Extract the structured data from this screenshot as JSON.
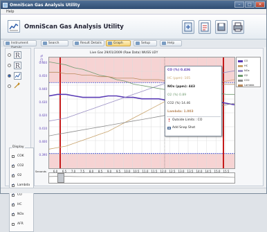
{
  "window": {
    "title": "OmniScan Gas Analysis Utility"
  },
  "menu": {
    "help": "Help"
  },
  "app": {
    "title": "OmniScan Gas Analysis Utility"
  },
  "toolbar": [
    {
      "icon": "export-icon"
    },
    {
      "icon": "settings-icon"
    },
    {
      "icon": "save-icon"
    },
    {
      "icon": "print-icon"
    }
  ],
  "tabs": [
    {
      "label": "Instrument Details",
      "active": false
    },
    {
      "label": "Search",
      "active": false
    },
    {
      "label": "Result Details",
      "active": false
    },
    {
      "label": "Graph",
      "active": true
    },
    {
      "label": "Setup",
      "active": false
    },
    {
      "label": "Help",
      "active": false
    }
  ],
  "sidebar": {
    "views": [
      {
        "icon": "data-view-icon",
        "selected": false
      },
      {
        "icon": "report-view-icon",
        "selected": false
      },
      {
        "icon": "graph-view-icon",
        "selected": true
      },
      {
        "icon": "tools-icon",
        "selected": false
      }
    ],
    "display_title": "Display",
    "gases": [
      {
        "label": "COK",
        "checked": false
      },
      {
        "label": "CO2",
        "checked": true
      },
      {
        "label": "O2",
        "checked": true
      },
      {
        "label": "Lambda",
        "checked": true
      },
      {
        "label": "CO",
        "checked": true
      },
      {
        "label": "HC",
        "checked": true
      },
      {
        "label": "NOx",
        "checked": true
      },
      {
        "label": "AFR",
        "checked": false
      }
    ]
  },
  "chart": {
    "title": "Live Gas 29/01/2009 (Raw Data) WUSS U2Y",
    "ylabel": "CO %",
    "xlabel": "Seconds",
    "popup": {
      "co": "CO (%) 0.436",
      "hc": "HC (ppm): 105",
      "nox": "NOx (ppm): 443",
      "o2": "O2 (%) 0.89",
      "co2": "CO2 (%) 14.46",
      "lambda": "Lambda: 1.003",
      "outside": "Outside Limits : CO",
      "snapshot": "Add Snap Shot"
    }
  },
  "chart_data": {
    "type": "line",
    "title": "Live Gas 29/01/2009 (Raw Data) WUSS U2Y",
    "xlabel": "Seconds",
    "ylabel": "CO %",
    "x": [
      5.0,
      5.5,
      6.0,
      6.5,
      7.0,
      7.5,
      8.0,
      8.5,
      9.0,
      9.5,
      10.0,
      10.5,
      11.0,
      11.5,
      12.0,
      12.5,
      13.0,
      13.5,
      14.0,
      14.5,
      15.0,
      15.5,
      16.0
    ],
    "xticks": [
      "6.0",
      "6.5",
      "7.0",
      "7.5",
      "8.0",
      "8.5",
      "9.0",
      "9.5",
      "10.0",
      "10.5",
      "11.0",
      "11.5",
      "12.0",
      "12.5",
      "13.0",
      "13.5",
      "14.0",
      "14.5",
      "15.0",
      "15.5"
    ],
    "yticks": [
      "0.460",
      "0.450",
      "0.440",
      "0.430",
      "0.420",
      "0.410",
      "0.400",
      "0.390"
    ],
    "ylim": [
      0.39,
      0.465
    ],
    "limit_lines": [
      0.448,
      0.4
    ],
    "series": [
      {
        "name": "CO",
        "color": "#5a3bb5",
        "values": [
          0.439,
          0.44,
          0.44,
          0.439,
          0.438,
          0.438,
          0.438,
          0.439,
          0.439,
          0.438,
          0.438,
          0.437,
          0.437,
          0.437,
          0.436,
          0.436,
          0.437,
          0.437,
          0.437,
          0.436,
          0.435,
          0.434,
          0.433
        ]
      },
      {
        "name": "HC",
        "color": "#c7a26a",
        "values": [
          0.403,
          0.404,
          0.405,
          0.407,
          0.409,
          0.411,
          0.413,
          0.415,
          0.418,
          0.421,
          0.424,
          0.427,
          0.43,
          0.433,
          0.436,
          0.438,
          0.44,
          0.442,
          0.444,
          0.446,
          0.448,
          0.449,
          0.45
        ]
      },
      {
        "name": "NOx",
        "color": "#9a8fc4",
        "values": [
          0.422,
          0.423,
          0.424,
          0.426,
          0.428,
          0.43,
          0.432,
          0.434,
          0.436,
          0.438,
          0.44,
          0.442,
          0.444,
          0.446,
          0.448,
          0.449,
          0.45,
          0.451,
          0.452,
          0.453,
          0.454,
          0.455,
          0.456
        ]
      },
      {
        "name": "O2",
        "color": "#6f9a6f",
        "values": [
          0.462,
          0.461,
          0.46,
          0.458,
          0.457,
          0.455,
          0.453,
          0.452,
          0.45,
          0.449,
          0.447,
          0.446,
          0.445,
          0.444,
          0.443,
          0.443,
          0.442,
          0.442,
          0.441,
          0.441,
          0.441,
          0.44,
          0.44
        ]
      },
      {
        "name": "CO2",
        "color": "#8c8c8c",
        "values": [
          0.412,
          0.413,
          0.414,
          0.415,
          0.416,
          0.417,
          0.418,
          0.419,
          0.42,
          0.421,
          0.422,
          0.423,
          0.424,
          0.425,
          0.426,
          0.427,
          0.428,
          0.429,
          0.43,
          0.431,
          0.432,
          0.433,
          0.434
        ]
      },
      {
        "name": "Lambda",
        "color": "#b98b5f",
        "values": [
          0.455,
          0.455,
          0.454,
          0.454,
          0.453,
          0.453,
          0.452,
          0.452,
          0.451,
          0.451,
          0.451,
          0.45,
          0.45,
          0.45,
          0.449,
          0.449,
          0.449,
          0.448,
          0.448,
          0.448,
          0.447,
          0.447,
          0.447
        ]
      }
    ]
  }
}
